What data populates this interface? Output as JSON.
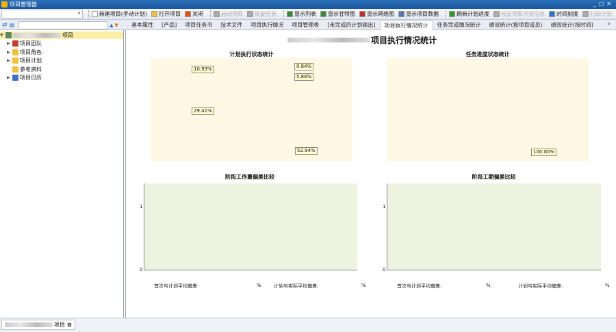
{
  "window": {
    "title": "项目管理器",
    "controls": [
      "minimize",
      "maximize",
      "close"
    ]
  },
  "toolbar": {
    "combo_value": "",
    "buttons": [
      {
        "label": "新建项目(手动计划)",
        "icon": "new-document-icon",
        "color": "#ffffff",
        "enabled": true
      },
      {
        "label": "打开项目",
        "icon": "folder-open-icon",
        "color": "#f0c040",
        "enabled": true
      },
      {
        "label": "关闭",
        "icon": "close-x-icon",
        "color": "#e05010",
        "enabled": true
      },
      {
        "label": "启动项目",
        "icon": "start-icon",
        "color": "#aaaaaa",
        "enabled": false
      },
      {
        "label": "恢复任务",
        "icon": "resume-icon",
        "color": "#aaaaaa",
        "enabled": false
      },
      {
        "label": "显示列表",
        "icon": "list-icon",
        "color": "#3a8a3a",
        "enabled": true
      },
      {
        "label": "显示甘特图",
        "icon": "gantt-icon",
        "color": "#3a8a3a",
        "enabled": true
      },
      {
        "label": "显示网络图",
        "icon": "network-icon",
        "color": "#c03030",
        "enabled": true
      },
      {
        "label": "显示项目数据",
        "icon": "data-icon",
        "color": "#5577aa",
        "enabled": true
      },
      {
        "label": "刷新计划进度",
        "icon": "refresh-icon",
        "color": "#2a9a2a",
        "enabled": true
      },
      {
        "label": "校正项目冲突信息",
        "icon": "filter-icon",
        "color": "#aaaaaa",
        "enabled": false
      },
      {
        "label": "时间刻度",
        "icon": "clock-icon",
        "color": "#3377cc",
        "enabled": true
      },
      {
        "label": "打印计划",
        "icon": "print-icon",
        "color": "#aaaaaa",
        "enabled": false
      }
    ]
  },
  "sidebar": {
    "search_value": "",
    "root_suffix": "项目",
    "items": [
      {
        "label": "项目团队",
        "icon": "team-icon"
      },
      {
        "label": "项目角色",
        "icon": "folder-icon"
      },
      {
        "label": "项目计划",
        "icon": "plan-folder-icon"
      },
      {
        "label": "参考资料",
        "icon": "reference-icon"
      },
      {
        "label": "项目日历",
        "icon": "calendar-icon"
      }
    ]
  },
  "tabs": [
    "基本属性",
    "[产品]",
    "项目任务书",
    "技术文件",
    "项目执行情况",
    "项目管理表",
    "[未完成的计划输出]",
    "项目执行情况统计",
    "任务完成情况统计",
    "绩效统计(按项目成员)",
    "绩效统计(按时间)"
  ],
  "active_tab": 7,
  "page": {
    "title": "项目执行情况统计"
  },
  "chart_data": [
    {
      "type": "pie",
      "title": "计划执行状态统计",
      "slices": [
        {
          "value": 0.84,
          "label": "0.84%",
          "color": "#3a6a2a"
        },
        {
          "value": 5.88,
          "label": "5.88%",
          "color": "#a0087a"
        },
        {
          "value": 52.94,
          "label": "52.94%",
          "color": "#c8e2b4"
        },
        {
          "value": 29.41,
          "label": "29.41%",
          "color": "#78c0c8"
        },
        {
          "value": 10.93,
          "label": "10.93%",
          "color": "#60b830"
        }
      ]
    },
    {
      "type": "pie",
      "title": "任务进度状态统计",
      "slices": [
        {
          "value": 100,
          "label": "100.00%",
          "color": "#e83838"
        }
      ]
    },
    {
      "type": "bar",
      "title": "阶段工作量偏差比较",
      "categories": [],
      "series": [],
      "ylim": [
        0,
        1
      ],
      "yticks": [
        "0",
        "1"
      ],
      "stats": [
        {
          "label": "首次与计划平均偏差:",
          "value": "",
          "unit": "%"
        },
        {
          "label": "计划与实际平均偏差:",
          "value": "",
          "unit": "%"
        }
      ]
    },
    {
      "type": "bar",
      "title": "阶段工期偏差比较",
      "categories": [],
      "series": [],
      "ylim": [
        0,
        1
      ],
      "yticks": [
        "0",
        "1"
      ],
      "stats": [
        {
          "label": "首次与计划平均偏差:",
          "value": "",
          "unit": "%"
        },
        {
          "label": "计划与实际平均偏差:",
          "value": "",
          "unit": "%"
        }
      ]
    }
  ],
  "statusbar": {
    "tab_label": "项目",
    "tab_close": "⊠"
  }
}
